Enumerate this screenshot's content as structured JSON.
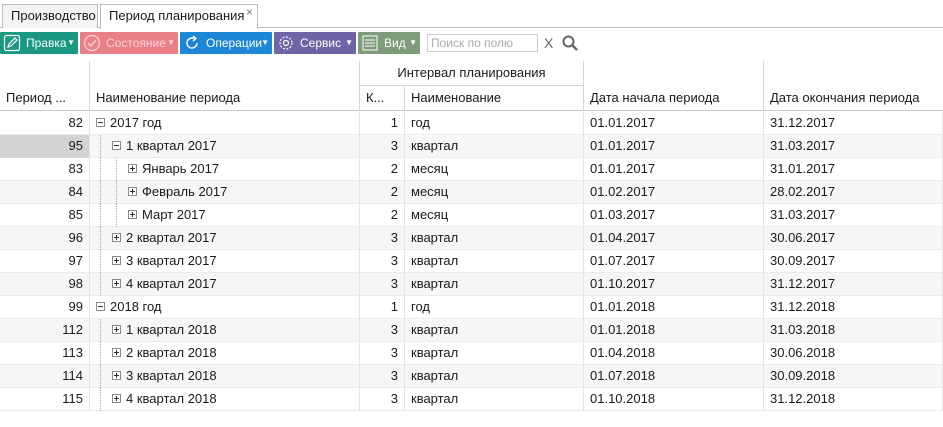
{
  "tabs": [
    {
      "label": "Производство"
    },
    {
      "label": "Период планирования",
      "close": "×"
    }
  ],
  "toolbar": {
    "edit": "Правка",
    "state": "Состояние",
    "ops": "Операции",
    "service": "Сервис",
    "view": "Вид",
    "search_placeholder": "Поиск по полю",
    "clear": "X"
  },
  "grid": {
    "group_header": "Интервал планирования",
    "headers": {
      "id": "Период ...",
      "name": "Наименование периода",
      "k": "К...",
      "interval": "Наименование",
      "start": "Дата начала периода",
      "end": "Дата окончания периода"
    },
    "rows": [
      {
        "id": "82",
        "name": "2017 год",
        "level": 0,
        "toggle": "minus",
        "k": "1",
        "interval": "год",
        "start": "01.01.2017",
        "end": "31.12.2017"
      },
      {
        "id": "95",
        "name": "1 квартал 2017",
        "level": 1,
        "toggle": "minus",
        "k": "3",
        "interval": "квартал",
        "start": "01.01.2017",
        "end": "31.03.2017",
        "selected": true
      },
      {
        "id": "83",
        "name": "Январь 2017",
        "level": 2,
        "toggle": "plus",
        "k": "2",
        "interval": "месяц",
        "start": "01.01.2017",
        "end": "31.01.2017"
      },
      {
        "id": "84",
        "name": "Февраль 2017",
        "level": 2,
        "toggle": "plus",
        "k": "2",
        "interval": "месяц",
        "start": "01.02.2017",
        "end": "28.02.2017"
      },
      {
        "id": "85",
        "name": "Март 2017",
        "level": 2,
        "toggle": "plus",
        "k": "2",
        "interval": "месяц",
        "start": "01.03.2017",
        "end": "31.03.2017"
      },
      {
        "id": "96",
        "name": "2 квартал 2017",
        "level": 1,
        "toggle": "plus",
        "k": "3",
        "interval": "квартал",
        "start": "01.04.2017",
        "end": "30.06.2017"
      },
      {
        "id": "97",
        "name": "3 квартал 2017",
        "level": 1,
        "toggle": "plus",
        "k": "3",
        "interval": "квартал",
        "start": "01.07.2017",
        "end": "30.09.2017"
      },
      {
        "id": "98",
        "name": "4 квартал 2017",
        "level": 1,
        "toggle": "plus",
        "k": "3",
        "interval": "квартал",
        "start": "01.10.2017",
        "end": "31.12.2017"
      },
      {
        "id": "99",
        "name": "2018 год",
        "level": 0,
        "toggle": "minus",
        "k": "1",
        "interval": "год",
        "start": "01.01.2018",
        "end": "31.12.2018"
      },
      {
        "id": "112",
        "name": "1 квартал 2018",
        "level": 1,
        "toggle": "plus",
        "k": "3",
        "interval": "квартал",
        "start": "01.01.2018",
        "end": "31.03.2018"
      },
      {
        "id": "113",
        "name": "2 квартал 2018",
        "level": 1,
        "toggle": "plus",
        "k": "3",
        "interval": "квартал",
        "start": "01.04.2018",
        "end": "30.06.2018"
      },
      {
        "id": "114",
        "name": "3 квартал 2018",
        "level": 1,
        "toggle": "plus",
        "k": "3",
        "interval": "квартал",
        "start": "01.07.2018",
        "end": "30.09.2018"
      },
      {
        "id": "115",
        "name": "4 квартал 2018",
        "level": 1,
        "toggle": "plus",
        "k": "3",
        "interval": "квартал",
        "start": "01.10.2018",
        "end": "31.12.2018"
      }
    ]
  }
}
